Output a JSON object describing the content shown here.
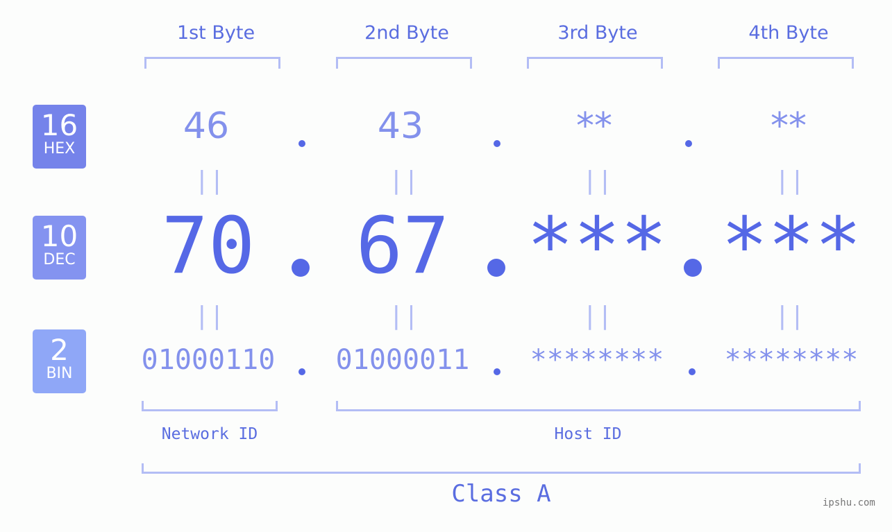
{
  "headers": [
    "1st Byte",
    "2nd Byte",
    "3rd Byte",
    "4th Byte"
  ],
  "badges": {
    "hex": {
      "num": "16",
      "label": "HEX",
      "color": "#7583ea"
    },
    "dec": {
      "num": "10",
      "label": "DEC",
      "color": "#8493f0"
    },
    "bin": {
      "num": "2",
      "label": "BIN",
      "color": "#8fa7f7"
    }
  },
  "hex": [
    "46",
    "43",
    "**",
    "**"
  ],
  "dec": [
    "70",
    "67",
    "***",
    "***"
  ],
  "bin": [
    "01000110",
    "01000011",
    "********",
    "********"
  ],
  "separator": ".",
  "equals": "||",
  "network_label": "Network ID",
  "host_label": "Host ID",
  "class_label": "Class A",
  "watermark": "ipshu.com"
}
